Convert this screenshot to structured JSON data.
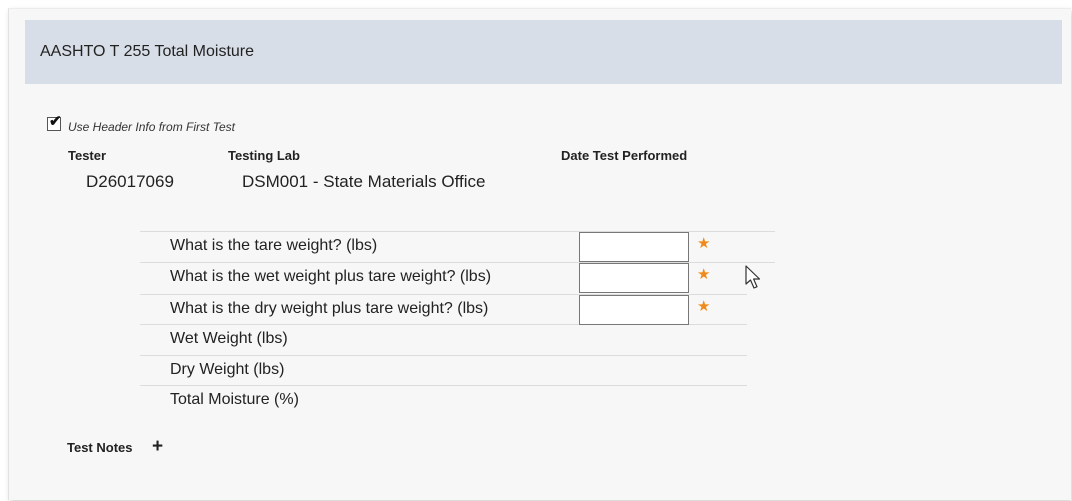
{
  "header": {
    "title": "AASHTO T 255 Total Moisture"
  },
  "header_info": {
    "checkbox_label": "Use Header Info from First Test",
    "checked": true,
    "columns": {
      "tester": "Tester",
      "testing_lab": "Testing Lab",
      "date_performed": "Date Test Performed"
    },
    "values": {
      "tester": "D26017069",
      "testing_lab": "DSM001 - State Materials Office",
      "date_performed": ""
    }
  },
  "questions": [
    {
      "label": "What is the tare weight? (lbs)",
      "value": "",
      "required": true
    },
    {
      "label": "What is the wet weight plus tare weight? (lbs)",
      "value": "",
      "required": true
    },
    {
      "label": "What is the dry weight plus tare weight? (lbs)",
      "value": "",
      "required": true
    },
    {
      "label": "Wet Weight (lbs)"
    },
    {
      "label": "Dry Weight (lbs)"
    },
    {
      "label": "Total Moisture (%)"
    }
  ],
  "notes": {
    "label": "Test Notes",
    "add_symbol": "+"
  },
  "icons": {
    "required": "star-icon",
    "cursor": "mouse-pointer-icon",
    "check": "checkmark-icon"
  },
  "colors": {
    "header_bg": "#d8dee8",
    "required_star": "#f08a1a"
  }
}
